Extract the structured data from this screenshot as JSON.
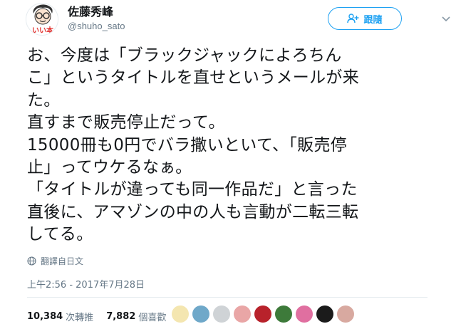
{
  "author": {
    "display_name": "佐藤秀峰",
    "handle": "@shuho_sato",
    "avatar_text": "いい本"
  },
  "follow_button": {
    "label": "跟隨"
  },
  "tweet": {
    "text": "お、今度は「ブラックジャックによろちん\nこ」というタイトルを直せというメールが来\nた。\n直すまで販売停止だって。\n15000冊も0円でバラ撒いといて、「販売停\n止」ってウケるなぁ。\n「タイトルが違っても同一作品だ」と言った\n直後に、アマゾンの中の人も言動が二転三転\nしてる。"
  },
  "translate": {
    "label": "翻譯自日文",
    "icon": "globe-icon"
  },
  "timestamp": "上午2:56 - 2017年7月28日",
  "stats": {
    "retweets_count": "10,384",
    "retweets_label": "次轉推",
    "likes_count": "7,882",
    "likes_label": "個喜歡"
  },
  "likers": [
    {
      "name": "liker-avatar-1",
      "color": "#f4e6b0"
    },
    {
      "name": "liker-avatar-2",
      "color": "#6fa8c9"
    },
    {
      "name": "liker-avatar-3",
      "color": "#cfd3d6"
    },
    {
      "name": "liker-avatar-4",
      "color": "#e9a6a6"
    },
    {
      "name": "liker-avatar-5",
      "color": "#b8222b"
    },
    {
      "name": "liker-avatar-6",
      "color": "#3d7a3a"
    },
    {
      "name": "liker-avatar-7",
      "color": "#e06fa0"
    },
    {
      "name": "liker-avatar-8",
      "color": "#1b1b1b"
    },
    {
      "name": "liker-avatar-9",
      "color": "#d8a9a0"
    }
  ],
  "colors": {
    "accent": "#1da1f2",
    "muted": "#657786",
    "text": "#14171a"
  }
}
